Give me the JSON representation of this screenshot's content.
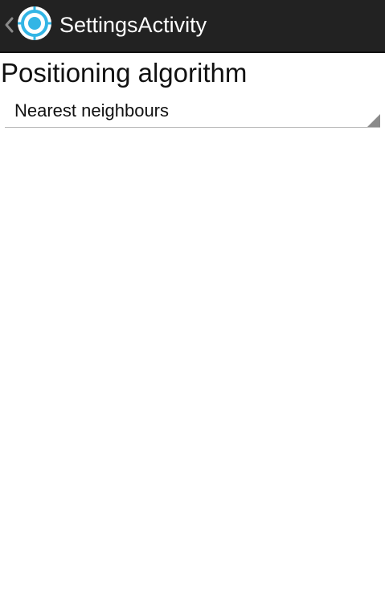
{
  "action_bar": {
    "title": "SettingsActivity",
    "up_icon": "chevron-left-icon",
    "app_icon": "target-icon",
    "background_color": "#222222",
    "accent_color": "#33b5e5"
  },
  "settings": {
    "section_title": "Positioning algorithm",
    "algorithm_spinner": {
      "selected_value": "Nearest neighbours",
      "indicator_icon": "dropdown-triangle-icon"
    }
  }
}
